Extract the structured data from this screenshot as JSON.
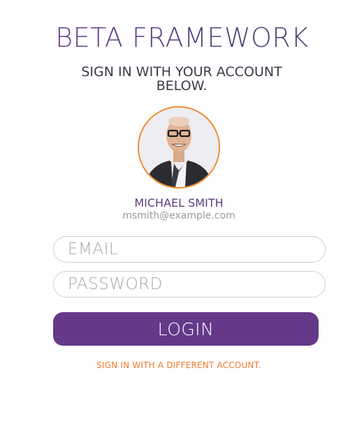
{
  "app": {
    "title": "BETA FRAMEWORK",
    "subtitle": "SIGN IN WITH YOUR ACCOUNT BELOW."
  },
  "user": {
    "name": "MICHAEL SMITH",
    "email": "msmith@example.com",
    "avatar_icon": "user-photo"
  },
  "form": {
    "email_placeholder": "EMAIL",
    "email_value": "",
    "password_placeholder": "PASSWORD",
    "password_value": "",
    "login_label": "LOGIN",
    "switch_account_label": "SIGN IN WITH A DIFFERENT ACCOUNT."
  },
  "colors": {
    "brand_purple": "#64398a",
    "accent_orange": "#f08a2c",
    "title_gradient_start": "#6a3f8e",
    "title_gradient_end": "#3b4a6a",
    "input_border": "#cfcfd4"
  }
}
